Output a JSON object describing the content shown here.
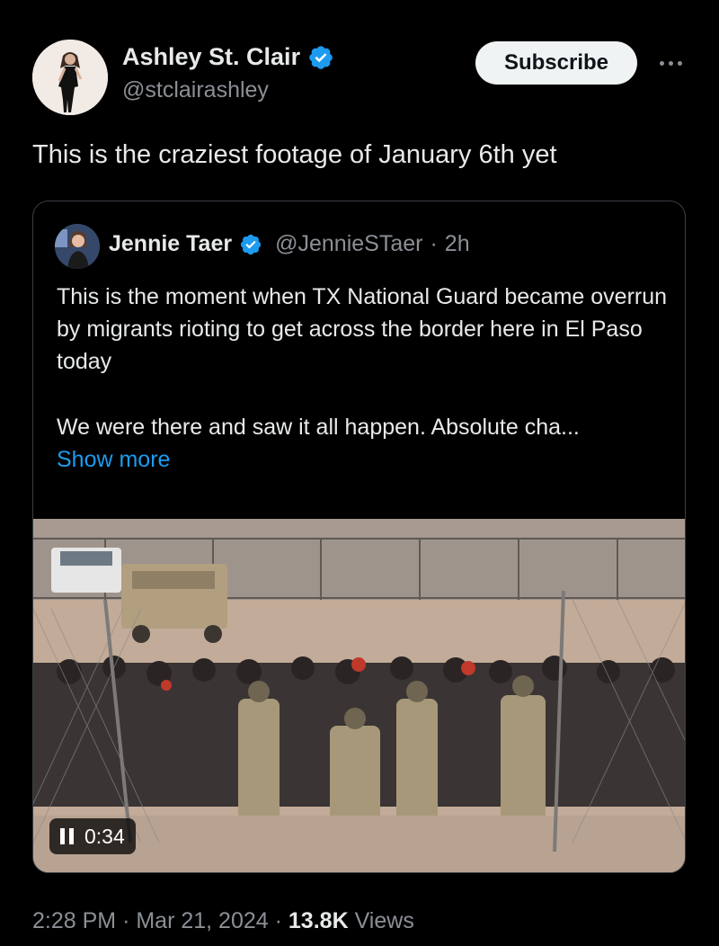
{
  "author": {
    "name": "Ashley St. Clair",
    "handle": "@stclairashley",
    "verified": true
  },
  "subscribe_label": "Subscribe",
  "tweet_text": "This is the craziest footage of January 6th yet",
  "quoted": {
    "name": "Jennie Taer",
    "handle": "@JennieSTaer",
    "separator": "·",
    "age": "2h",
    "text_line1": "This is the moment when TX National Guard became overrun by migrants rioting to get across the border here in El Paso today",
    "text_line2": "We were there and saw it all happen. Absolute cha...",
    "show_more": "Show more",
    "video_time": "0:34"
  },
  "meta": {
    "time": "2:28 PM",
    "sep1": "·",
    "date": "Mar 21, 2024",
    "sep2": "·",
    "views_count": "13.8K",
    "views_label": "Views"
  },
  "colors": {
    "background": "#000000",
    "text": "#e7e9ea",
    "secondary": "#8b9096",
    "link": "#1d9bf0",
    "verified": "#1d9bf0"
  }
}
